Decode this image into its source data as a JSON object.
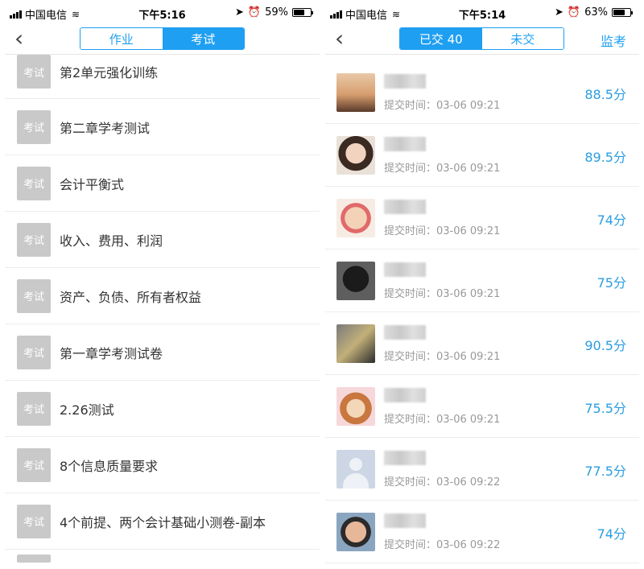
{
  "left": {
    "status": {
      "carrier": "中国电信",
      "time": "下午5:16",
      "battery": "59%",
      "battery_level": 0.59
    },
    "segment": {
      "tab1": "作业",
      "tab2": "考试",
      "active": "考试"
    },
    "exams": [
      {
        "tag": "考试",
        "title": "第2单元强化训练"
      },
      {
        "tag": "考试",
        "title": "第二章学考测试"
      },
      {
        "tag": "考试",
        "title": "会计平衡式"
      },
      {
        "tag": "考试",
        "title": "收入、费用、利润"
      },
      {
        "tag": "考试",
        "title": "资产、负债、所有者权益"
      },
      {
        "tag": "考试",
        "title": "第一章学考测试卷"
      },
      {
        "tag": "考试",
        "title": "2.26测试"
      },
      {
        "tag": "考试",
        "title": "8个信息质量要求"
      },
      {
        "tag": "考试",
        "title": "4个前提、两个会计基础小测卷-副本"
      }
    ]
  },
  "right": {
    "status": {
      "carrier": "中国电信",
      "time": "下午5:14",
      "battery": "63%",
      "battery_level": 0.63
    },
    "segment": {
      "tab1": "已交 40",
      "tab2": "未交",
      "active": "已交 40"
    },
    "action": "监考",
    "submissions": [
      {
        "time": "提交时间：03-06 09:21",
        "score": "88.5分"
      },
      {
        "time": "提交时间：03-06 09:21",
        "score": "89.5分"
      },
      {
        "time": "提交时间：03-06 09:21",
        "score": "74分"
      },
      {
        "time": "提交时间：03-06 09:21",
        "score": "75分"
      },
      {
        "time": "提交时间：03-06 09:21",
        "score": "90.5分"
      },
      {
        "time": "提交时间：03-06 09:21",
        "score": "75.5分"
      },
      {
        "time": "提交时间：03-06 09:22",
        "score": "77.5分"
      },
      {
        "time": "提交时间：03-06 09:22",
        "score": "74分"
      }
    ]
  }
}
